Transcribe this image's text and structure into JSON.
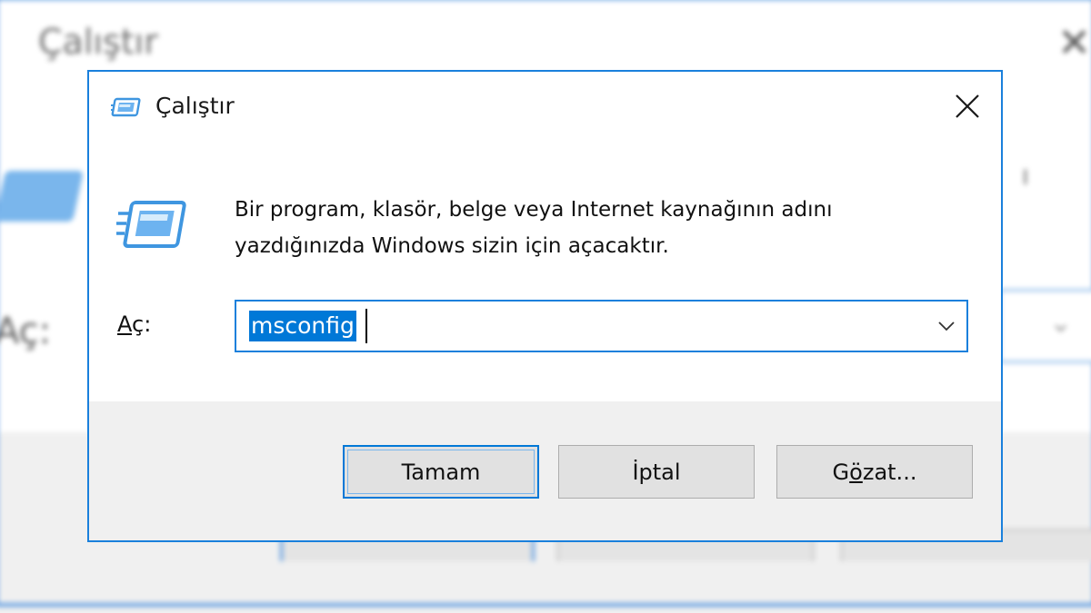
{
  "window": {
    "title": "Çalıştır",
    "title_icon": "run-icon",
    "close_icon": "close-icon"
  },
  "content": {
    "description_line1": "Bir program, klasör, belge veya Internet kaynağının adını",
    "description_line2": "yazdığınızda Windows sizin için açacaktır.",
    "big_icon": "run-icon",
    "open_label_mnemonic": "A",
    "open_label_rest": "ç:",
    "open_value": "msconfig",
    "dropdown_icon": "chevron-down-icon"
  },
  "buttons": {
    "ok": "Tamam",
    "cancel": "İptal",
    "browse_pre": "G",
    "browse_mnemonic": "ö",
    "browse_post": "zat..."
  },
  "colors": {
    "accent": "#0078d7",
    "frame": "#1a80dc",
    "dialog_bg": "#f0f0f0",
    "content_bg": "#ffffff"
  }
}
